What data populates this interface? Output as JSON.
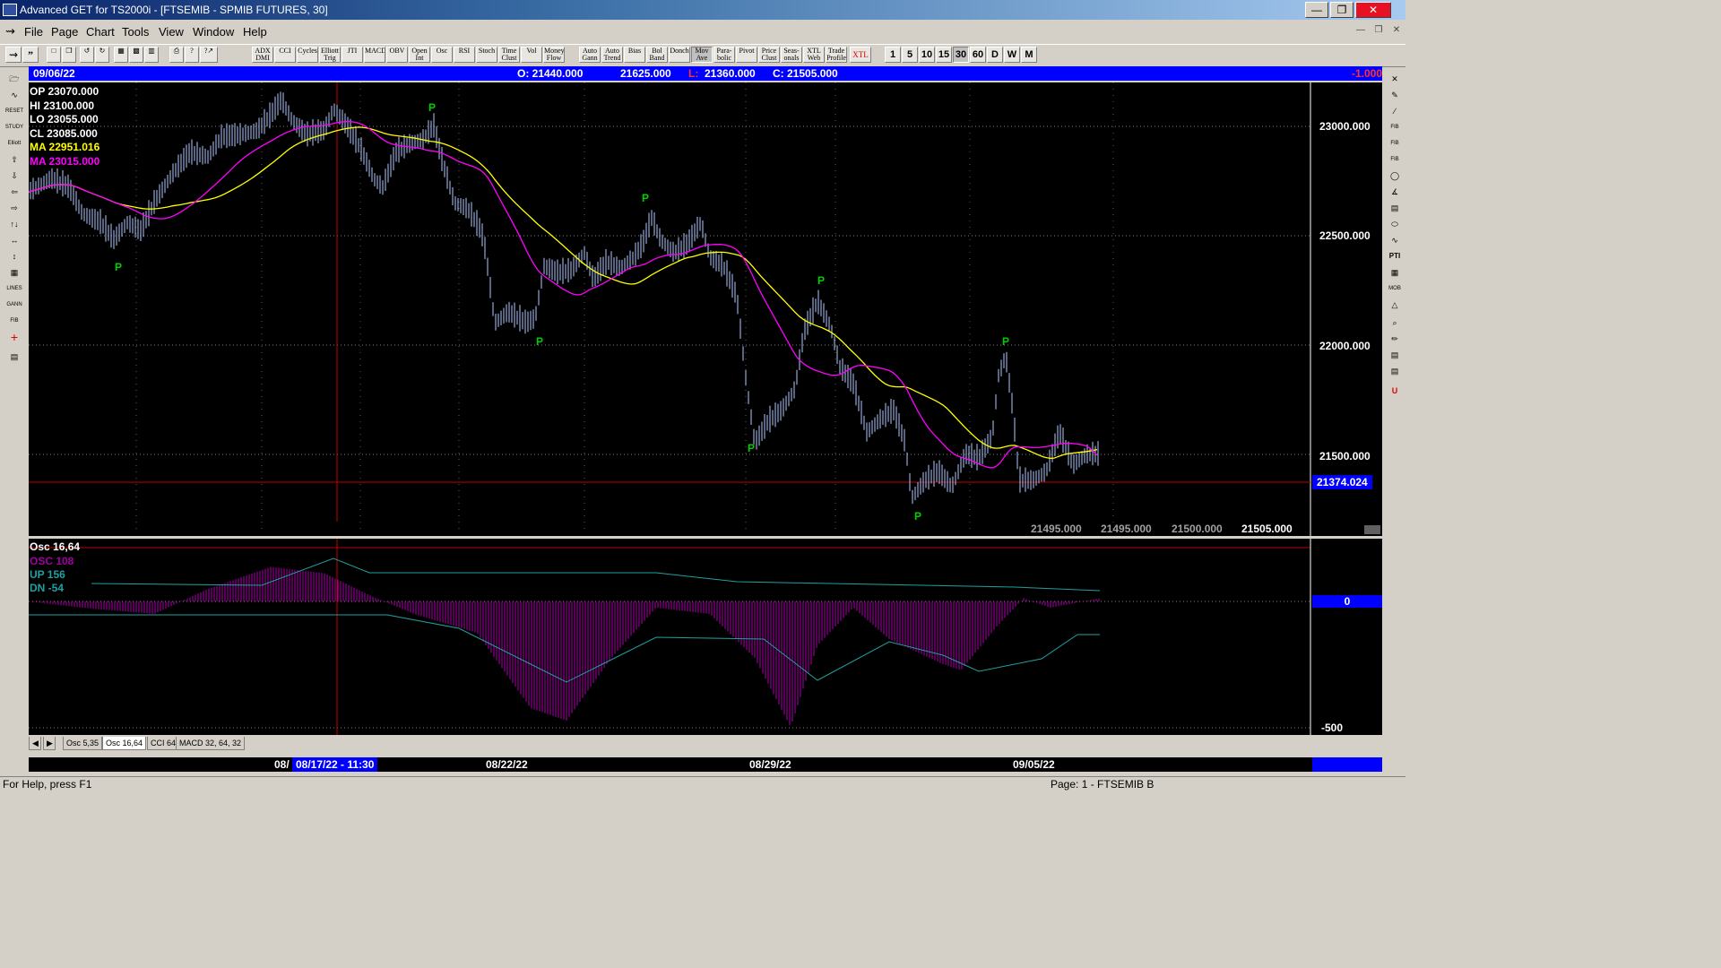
{
  "window": {
    "title": "Advanced GET for TS2000i - [FTSEMIB - SPMIB FUTURES, 30]"
  },
  "menu": [
    "File",
    "Page",
    "Chart",
    "Tools",
    "View",
    "Window",
    "Help"
  ],
  "toolbar": {
    "studies": [
      "ADX DMI",
      "CCI",
      "Cycles",
      "Elliott Trig",
      "JTI",
      "MACD",
      "OBV",
      "Open Int",
      "Osc",
      "RSI",
      "Stoch",
      "Time Clust",
      "Vol",
      "Money Flow",
      "Auto Gann",
      "Auto Trend",
      "Bias",
      "Bol Band",
      "Donch",
      "Mov Ave",
      "Para-bolic",
      "Pivot",
      "Price Clust",
      "Seas-onals",
      "XTL Web",
      "Trade Profile",
      "XTL"
    ],
    "intervals": [
      "1",
      "5",
      "10",
      "15",
      "30",
      "60",
      "D",
      "W",
      "M"
    ],
    "active_interval": "30"
  },
  "header": {
    "date": "09/06/22",
    "open": "O: 21440.000",
    "high": "21625.000",
    "low_prefix": "L:",
    "low": "21360.000",
    "close": "C: 21505.000",
    "change": "-1.000"
  },
  "price_stats": {
    "op": "OP  23070.000",
    "hi": "HI   23100.000",
    "lo": "LO  23055.000",
    "cl": "CL  23085.000",
    "ma1": "MA  22951.016",
    "ma2": "MA  23015.000"
  },
  "price_axis": {
    "labels": [
      "23000.000",
      "22500.000",
      "22000.000",
      "21500.000"
    ],
    "current": "21374.024"
  },
  "bottom_values": [
    "21495.000",
    "21495.000",
    "21500.000",
    "21505.000"
  ],
  "pivot_label": "P",
  "osc_stats": {
    "title": "Osc 16,64",
    "osc": "OSC 108",
    "up": "UP    156",
    "dn": "DN    -54"
  },
  "osc_axis": {
    "zero": "0",
    "minus500": "-500"
  },
  "tabs": [
    "Osc 5,35",
    "Osc 16,64",
    "CCI 64",
    "MACD 32, 64, 32"
  ],
  "active_tab": "Osc 16,64",
  "time_axis": {
    "labels": [
      "08/",
      "08/17/22 - 11:30",
      "08/22/22",
      "08/29/22",
      "09/05/22"
    ]
  },
  "status": {
    "help": "For Help, press F1",
    "page": "Page: 1 - FTSEMIB B"
  },
  "colors": {
    "ma_fast": "#ffff00",
    "ma_slow": "#ff00ff",
    "bars": "#b0c8ff",
    "pivot": "#00d000",
    "header_blue": "#0000ff"
  }
}
